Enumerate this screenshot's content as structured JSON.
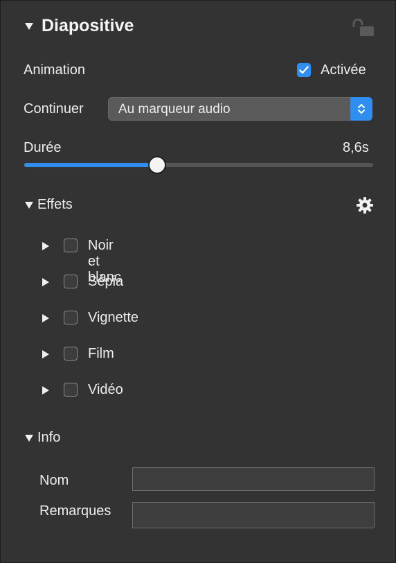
{
  "panel": {
    "title": "Diapositive",
    "lock_icon": "lock-open-icon"
  },
  "animation": {
    "label": "Animation",
    "checkbox_label": "Activée",
    "checked": true
  },
  "continue": {
    "label": "Continuer",
    "selected": "Au marqueur audio"
  },
  "duration": {
    "label": "Durée",
    "value": "8,6s",
    "fill_percent": 38
  },
  "effects": {
    "title": "Effets",
    "gear_icon": "gear-icon",
    "items": [
      {
        "label": "Noir et blanc",
        "checked": false
      },
      {
        "label": "Sépia",
        "checked": false
      },
      {
        "label": "Vignette",
        "checked": false
      },
      {
        "label": "Film",
        "checked": false
      },
      {
        "label": "Vidéo",
        "checked": false
      }
    ]
  },
  "info": {
    "title": "Info",
    "name_label": "Nom",
    "name_value": "",
    "notes_label": "Remarques",
    "notes_value": ""
  },
  "colors": {
    "accent": "#2f8ef0",
    "background": "#333333"
  }
}
